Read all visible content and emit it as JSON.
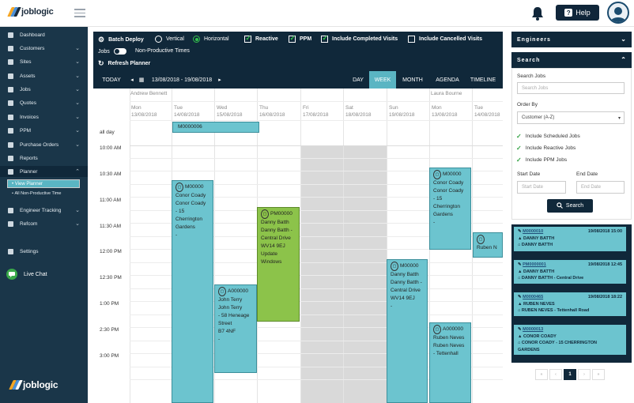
{
  "brand": {
    "name": "joblogic"
  },
  "header": {
    "help_label": "Help"
  },
  "sidebar": {
    "items": [
      {
        "label": "Dashboard",
        "chev": ""
      },
      {
        "label": "Customers",
        "chev": "⌄"
      },
      {
        "label": "Sites",
        "chev": "⌄"
      },
      {
        "label": "Assets",
        "chev": "⌄"
      },
      {
        "label": "Jobs",
        "chev": "⌄"
      },
      {
        "label": "Quotes",
        "chev": "⌄"
      },
      {
        "label": "Invoices",
        "chev": "⌄"
      },
      {
        "label": "PPM",
        "chev": "⌄"
      },
      {
        "label": "Purchase Orders",
        "chev": "⌄"
      },
      {
        "label": "Reports",
        "chev": ""
      },
      {
        "label": "Planner",
        "chev": "⌃"
      }
    ],
    "planner_sub": [
      "View Planner",
      "All Non-Productive Time"
    ],
    "items2": [
      {
        "label": "Engineer Tracking",
        "chev": "⌄"
      },
      {
        "label": "Refcom",
        "chev": "⌄"
      }
    ],
    "settings": "Settings",
    "live_chat": "Live Chat"
  },
  "toolbar": {
    "batch_deploy": "Batch Deploy",
    "vertical": "Vertical",
    "horizontal": "Horizontal",
    "reactive": "Reactive",
    "ppm": "PPM",
    "include_completed": "Include Completed Visits",
    "include_cancelled": "Include Cancelled Visits",
    "jobs": "Jobs",
    "non_productive": "Non-Productive Times",
    "refresh": "Refresh Planner"
  },
  "navbar": {
    "today": "TODAY",
    "range": "13/08/2018 - 19/08/2018",
    "views": [
      "DAY",
      "WEEK",
      "MONTH",
      "AGENDA",
      "TIMELINE"
    ],
    "active_view": "WEEK"
  },
  "calendar": {
    "resources": [
      "Andrew Bennett",
      "Laura Bourne"
    ],
    "days": [
      {
        "d": "Mon",
        "date": "13/08/2018"
      },
      {
        "d": "Tue",
        "date": "14/08/2018"
      },
      {
        "d": "Wed",
        "date": "15/08/2018"
      },
      {
        "d": "Thu",
        "date": "16/08/2018"
      },
      {
        "d": "Fri",
        "date": "17/08/2018"
      },
      {
        "d": "Sat",
        "date": "18/08/2018"
      },
      {
        "d": "Sun",
        "date": "19/08/2018"
      },
      {
        "d": "Mon",
        "date": "13/08/2018"
      },
      {
        "d": "Tue",
        "date": "14/08/2018"
      }
    ],
    "all_day": "all day",
    "times": [
      "10:00 AM",
      "10:30 AM",
      "11:00 AM",
      "11:30 AM",
      "12:00 PM",
      "12:30 PM",
      "1:00 PM",
      "2:30 PM",
      "3:00 PM"
    ],
    "allday_event": "M0000006",
    "events": [
      {
        "code": "M00000",
        "lines": [
          "Conor Coady",
          "Conor Coady",
          "- 15",
          "Cherrington",
          "Gardens",
          "-"
        ]
      },
      {
        "code": "A000000",
        "lines": [
          "John Terry",
          "John Terry",
          "- 58 Heneage",
          "Street",
          "B7 4NF",
          "-"
        ]
      },
      {
        "code": "PM00000",
        "lines": [
          "Danny Batth",
          "Danny Batth -",
          "Central Drive",
          "WV14 9EJ",
          "Update",
          "Windows"
        ]
      },
      {
        "code": "M00000",
        "lines": [
          "Danny Batth",
          "Danny Batth -",
          "Central Drive",
          "WV14 9EJ",
          "-"
        ]
      },
      {
        "code": "M00000",
        "lines": [
          "Conor Coady",
          "Conor Coady",
          "- 15",
          "Cherrington",
          "Gardens",
          "-"
        ]
      },
      {
        "code": "A000000",
        "lines": [
          "Ruben Neves",
          "Ruben Neves",
          "- Tettenhall"
        ]
      },
      {
        "code": "",
        "lines": [
          "Ruben N"
        ]
      }
    ]
  },
  "right": {
    "engineers_title": "Engineers",
    "search_title": "Search",
    "search_jobs_label": "Search Jobs",
    "search_jobs_placeholder": "Search Jobs",
    "order_by_label": "Order By",
    "order_by_value": "Customer (A-Z)",
    "include": [
      "Include Scheduled Jobs",
      "Include Reactive Jobs",
      "Include PPM Jobs"
    ],
    "start_date_label": "Start Date",
    "end_date_label": "End Date",
    "start_date_placeholder": "Start Date",
    "end_date_placeholder": "End Date",
    "search_button": "Search",
    "jobs": [
      {
        "code": "M0000010",
        "date": "19/08/2018 15:00",
        "line1": "DANNY BATTH",
        "line2": "DANNY BATTH"
      },
      {
        "code": "PM0000001",
        "date": "19/08/2018 12:45",
        "line1": "DANNY BATTH",
        "line2": "DANNY BATTH - Central Drive"
      },
      {
        "code": "M0000465",
        "date": "19/08/2018 18:22",
        "line1": "RUBEN NEVES",
        "line2": "RUBEN NEVES - Tettenhall Road"
      },
      {
        "code": "M0000013",
        "date": "",
        "line1": "CONOR COADY",
        "line2": "CONOR COADY - 15 CHERRINGTON",
        "line3": "GARDENS"
      }
    ],
    "pager": [
      "«",
      "‹",
      "1",
      "›",
      "»"
    ]
  },
  "colors": {
    "navy": "#10283a",
    "teal": "#6cc4cf",
    "green": "#8cc34a",
    "sidebar": "#1a3649"
  }
}
